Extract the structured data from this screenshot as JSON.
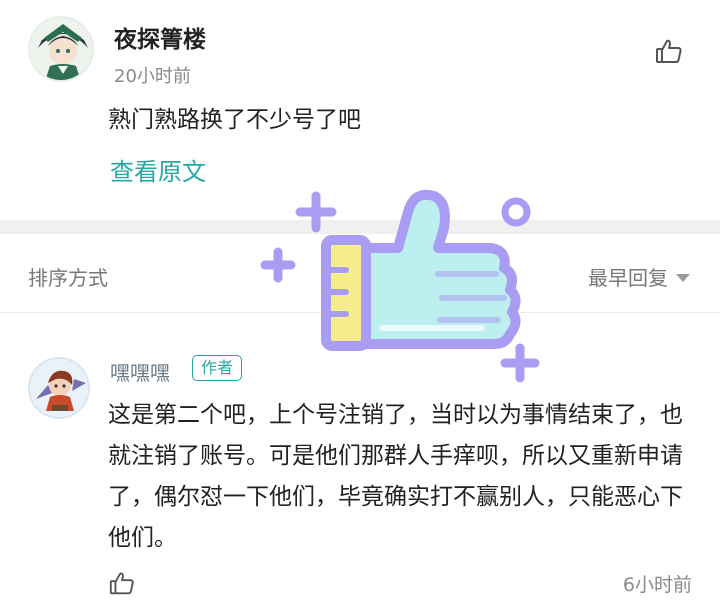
{
  "top_comment": {
    "username": "夜探箐楼",
    "time": "20小时前",
    "text": "熟门熟路换了不少号了吧",
    "view_original": "查看原文"
  },
  "sort_bar": {
    "label": "排序方式",
    "selected": "最早回复"
  },
  "reply": {
    "username": "嘿嘿嘿",
    "badge": "作者",
    "text": "这是第二个吧，上个号注销了，当时以为事情结束了，也就注销了账号。可是他们那群人手痒呗，所以又重新申请了，偶尔怼一下他们，毕竟确实打不赢别人，只能恶心下他们。",
    "time": "6小时前"
  },
  "icons": {
    "top_like": "thumbs-up-icon",
    "reply_like": "thumbs-up-icon",
    "sort_caret": "caret-down-icon",
    "sticker": "thumbs-up-sticker"
  },
  "colors": {
    "accent": "#27a7a3",
    "sticker_outline": "#a99cf3",
    "sticker_fill": "#bdeff0",
    "sticker_cuff": "#f5ec8a"
  }
}
